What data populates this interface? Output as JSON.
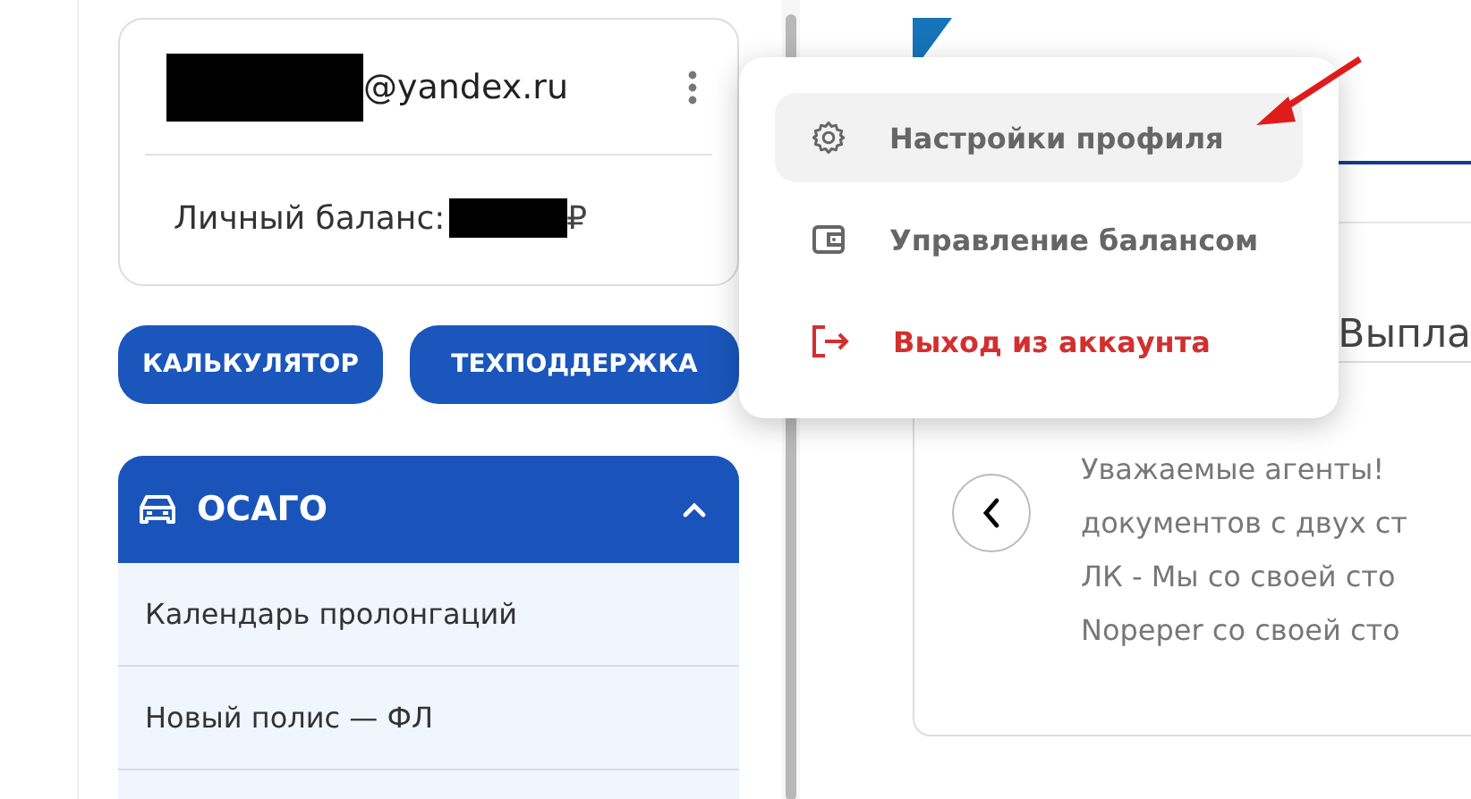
{
  "account": {
    "email_suffix": "@yandex.ru",
    "balance_label": "Личный баланс:",
    "currency": "₽"
  },
  "buttons": [
    "КАЛЬКУЛЯТОР",
    "ТЕХПОДДЕРЖКА"
  ],
  "nav": {
    "title": "ОСАГО",
    "expanded": true,
    "items": [
      "Календарь пролонгаций",
      "Новый полис — ФЛ"
    ]
  },
  "menu": [
    {
      "kind": "settings",
      "label": "Настройки профиля",
      "selected": true
    },
    {
      "kind": "wallet",
      "label": "Управление балансом",
      "selected": false
    },
    {
      "kind": "logout",
      "label": "Выход из аккаунта",
      "selected": false
    }
  ],
  "content": {
    "heading": "Выпла",
    "news_lines": [
      "Уважаемые агенты!",
      "документов с двух ст",
      "ЛК - Мы со своей сто",
      "Nopeper со своей сто"
    ]
  }
}
